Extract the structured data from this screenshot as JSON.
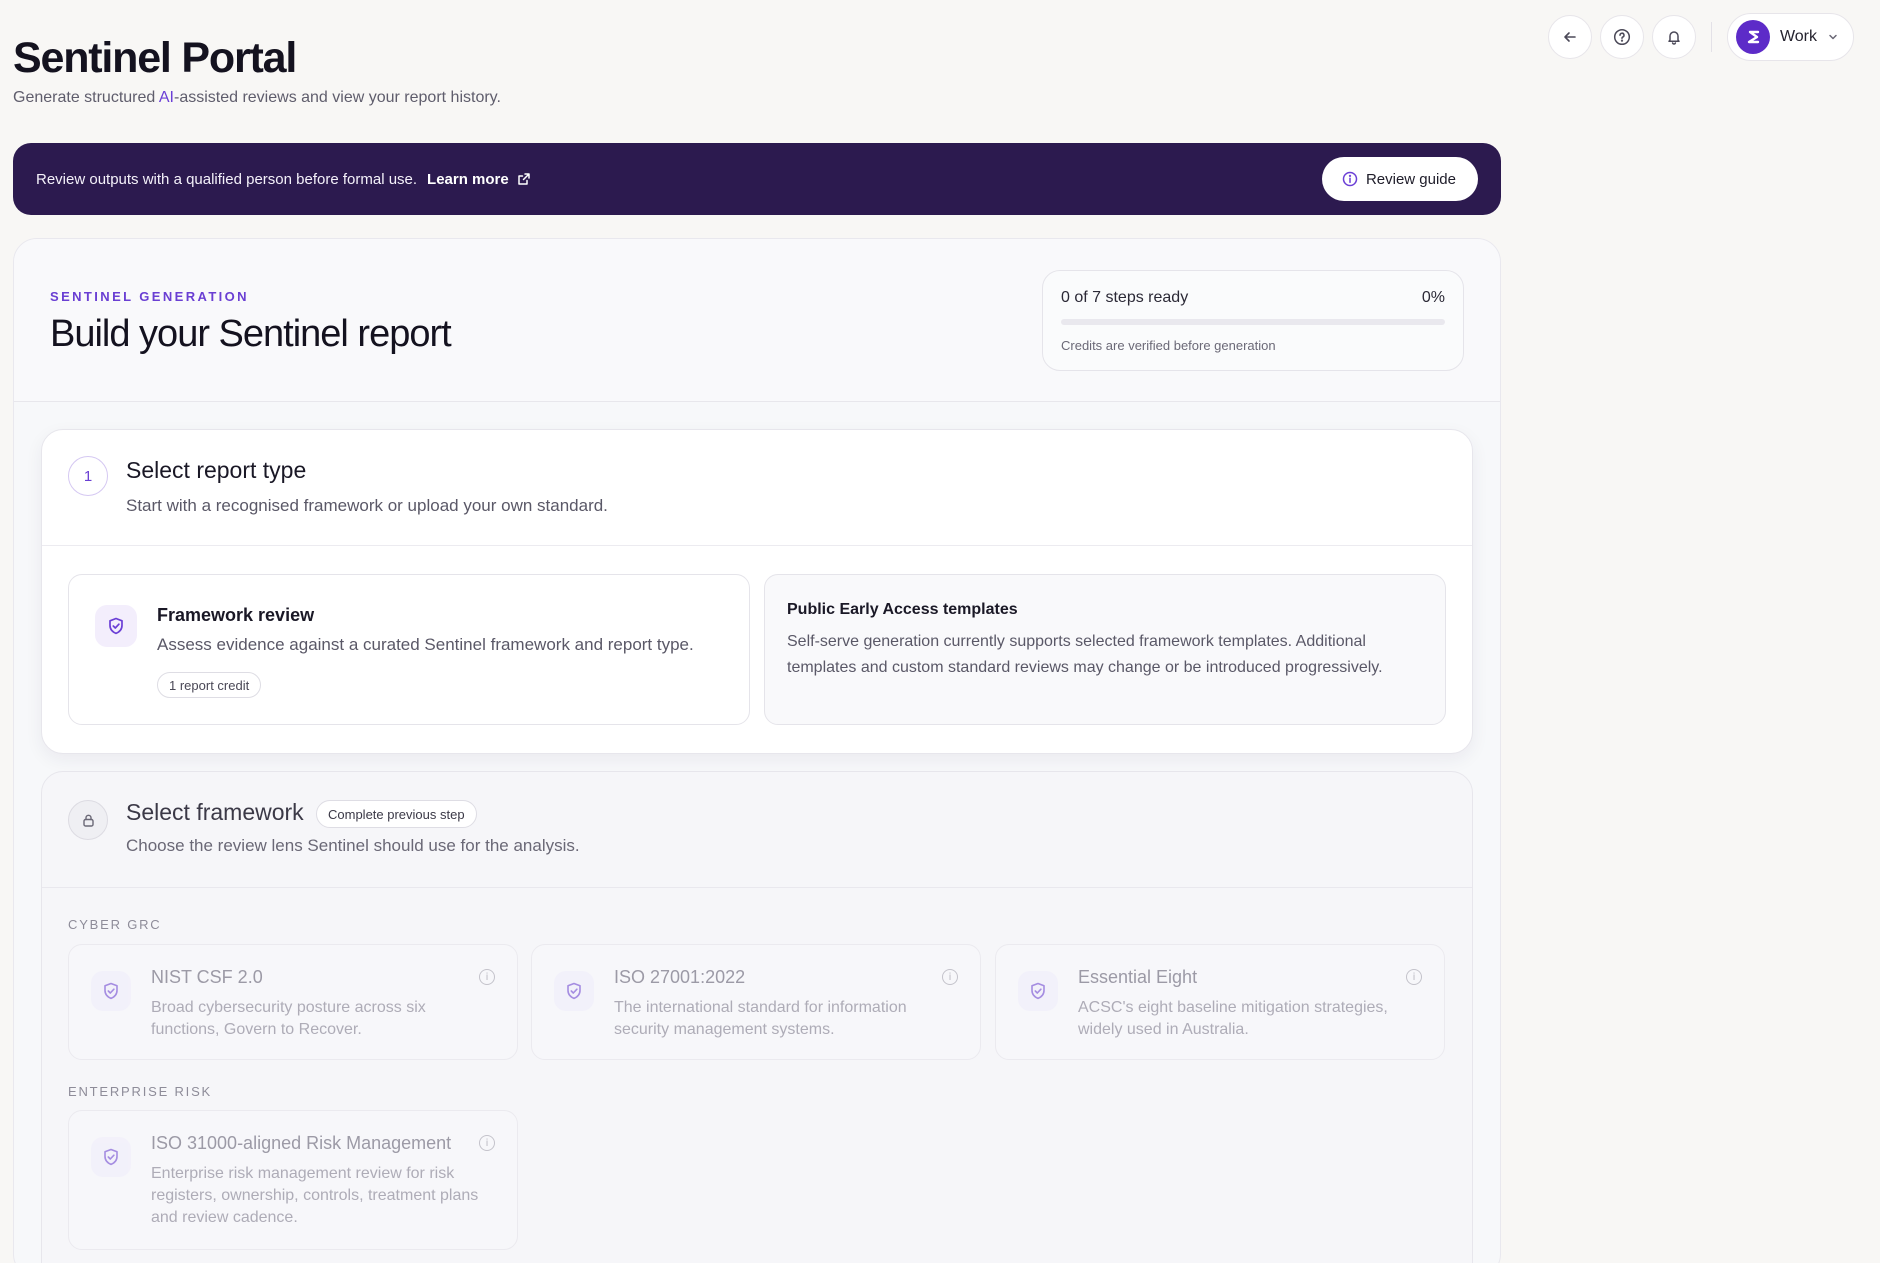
{
  "header": {
    "title": "Sentinel Portal",
    "subtitle_before": "Generate structured ",
    "subtitle_ai": "AI",
    "subtitle_after": "-assisted reviews and view your report history."
  },
  "top_actions": {
    "back_icon": "arrow-left-icon",
    "help_icon": "help-circle-icon",
    "bell_icon": "bell-icon",
    "workspace_label": "Work"
  },
  "banner": {
    "text": "Review outputs with a qualified person before formal use.",
    "link_label": "Learn more",
    "guide_button": "Review guide"
  },
  "builder": {
    "eyebrow": "SENTINEL GENERATION",
    "title": "Build your Sentinel report",
    "progress_text": "0 of 7 steps ready",
    "progress_percent_label": "0%",
    "progress_value": 0,
    "progress_note": "Credits are verified before generation"
  },
  "step1": {
    "number": "1",
    "title": "Select report type",
    "description": "Start with a recognised framework or upload your own standard.",
    "framework_option": {
      "title": "Framework review",
      "description": "Assess evidence against a curated Sentinel framework and report type.",
      "chip": "1 report credit"
    },
    "public_note": {
      "title": "Public Early Access templates",
      "description": "Self-serve generation currently supports selected framework templates. Additional templates and custom standard reviews may change or be introduced progressively."
    }
  },
  "step2": {
    "title": "Select framework",
    "tag": "Complete previous step",
    "description": "Choose the review lens Sentinel should use for the analysis.",
    "groups": [
      {
        "label": "CYBER GRC",
        "frameworks": [
          {
            "title": "NIST CSF 2.0",
            "description": "Broad cybersecurity posture across six functions, Govern to Recover."
          },
          {
            "title": "ISO 27001:2022",
            "description": "The international standard for information security management systems."
          },
          {
            "title": "Essential Eight",
            "description": "ACSC's eight baseline mitigation strategies, widely used in Australia."
          }
        ]
      },
      {
        "label": "ENTERPRISE RISK",
        "frameworks": [
          {
            "title": "ISO 31000-aligned Risk Management",
            "description": "Enterprise risk management review for risk registers, ownership, controls, treatment plans and review cadence."
          }
        ]
      }
    ]
  },
  "colors": {
    "accent": "#6b3fd6",
    "banner_bg": "#2c1a4f",
    "page_bg": "#f8f7f5"
  }
}
